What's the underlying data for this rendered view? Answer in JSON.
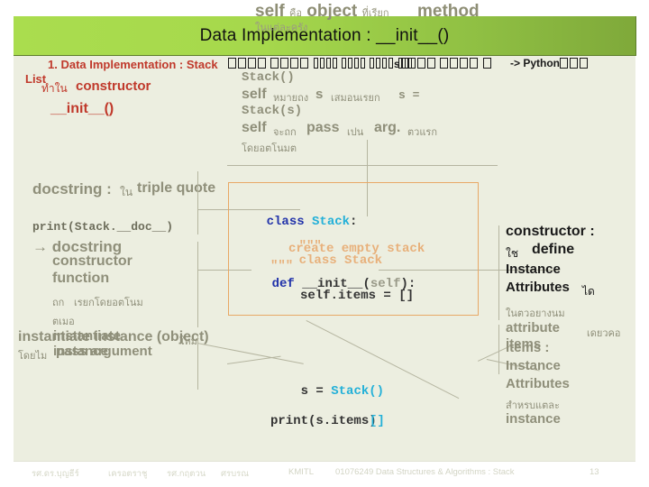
{
  "slide": {
    "header": {
      "title": "Data Implementation : __init__()",
      "overlay_self": "self",
      "overlay_thai1": "คือ",
      "overlay_object": "object",
      "overlay_thai2": "ที่เรียก",
      "overlay_method": "method",
      "overlay_line2": "ในแต่ละครัง"
    },
    "bullet": {
      "number_label": "1. Data Implementation : Stack",
      "thai_tofu_run1": 8,
      "thai_tofu_run2": 18,
      "inline_s": "s",
      "thai_tofu_run3": 8,
      "arrow_python": "-> Python",
      "thai_tofu_run4": 1,
      "list_label": "List"
    },
    "left_top": {
      "thai_tamnai": "ทำใน",
      "constructor": "constructor",
      "init": "__init__()"
    },
    "mid_top": {
      "line1": "Stack()",
      "self": "self",
      "thai_maithueng": "หมายถง",
      "s_letter": "s",
      "thai_samernraek": "เสมอนเรยก",
      "s_equals": "s =",
      "line3": "Stack(s)",
      "self2": "self",
      "thai_jathuk": "จะถก",
      "pass": "pass",
      "thai_pen": "เปน",
      "arg": "arg.",
      "thai_tuaraek": "ตวแรก",
      "thai_doiautonomat": "โดยอตโนมต"
    },
    "left_mid": {
      "docstring_label": "docstring :",
      "thai_nai": "ใน",
      "triple_quote": "triple quote",
      "print_call": "print(Stack.__doc__)",
      "arrow": "→",
      "docstring2": "docstring",
      "constructor_fn_1": "constructor",
      "constructor_fn_2": "function",
      "thai_thuk": "ถก",
      "thai_riakdoiauto": "เรยกโดยอตโนม",
      "thai_tameo": "ตเมอ"
    },
    "left_bottom": {
      "instantiate_a": "instantiate",
      "instance_object": "instance (object)",
      "thai_mai": "ใหม",
      "instantiate_b": "instantiate",
      "instance_b": "instance",
      "thai_doimai": "โดยไม",
      "pass_argument": "pass argument"
    },
    "code": {
      "l1_kw": "class",
      "l1_cls": "Stack",
      "l1_colon": ":",
      "l2_quote": "\"\"\"",
      "l2_text": "class Stack",
      "l3_text": "create empty stack",
      "l4_quote": "\"\"\"",
      "l5_kw": "def",
      "l5_name": "__init__",
      "l5_open": "(",
      "l5_self": "self",
      "l5_close": "):",
      "l6_text": "self.items = []"
    },
    "code_bottom": {
      "assign_s": "s =",
      "assign_call": "Stack()",
      "print_call": "print(s.items)",
      "print_result": "[]"
    },
    "right": {
      "constructor_label": "constructor :",
      "thai_chai": "ใช",
      "define": "define",
      "instance": "Instance",
      "attributes": "Attributes",
      "thai_dai": "ได",
      "thai_naituayang": "ในตวอยางนม",
      "attribute": "attribute",
      "thai_diaokhue": "เดยวคอ",
      "items_overlay": "items",
      "items_label": "items :",
      "instance2": "Instance",
      "attributes2": "Attributes",
      "thai_samrapthaela": "สำหรบแตละ",
      "instance3": "instance"
    },
    "footer": {
      "name1": "รศ.ดร.บุญธีร์",
      "name2": "เครอตราชู",
      "name3": "รศ.กฤตวน",
      "name4": "ศรบรณ",
      "org": "KMITL",
      "course": "01076249 Data Structures & Algorithms : Stack",
      "page": "13"
    },
    "colors": {
      "header_green_light": "#aadd4e",
      "header_green_dark": "#7fa93a",
      "panel_bg": "#eceee0",
      "accent_red": "#c0392b",
      "code_keyword": "#2233aa",
      "code_classname": "#23b0d8",
      "code_docstring": "#e8b07a",
      "code_box_border": "#e8a866",
      "connector": "#b5b5a0",
      "body_gray": "#8f8f7a"
    }
  }
}
